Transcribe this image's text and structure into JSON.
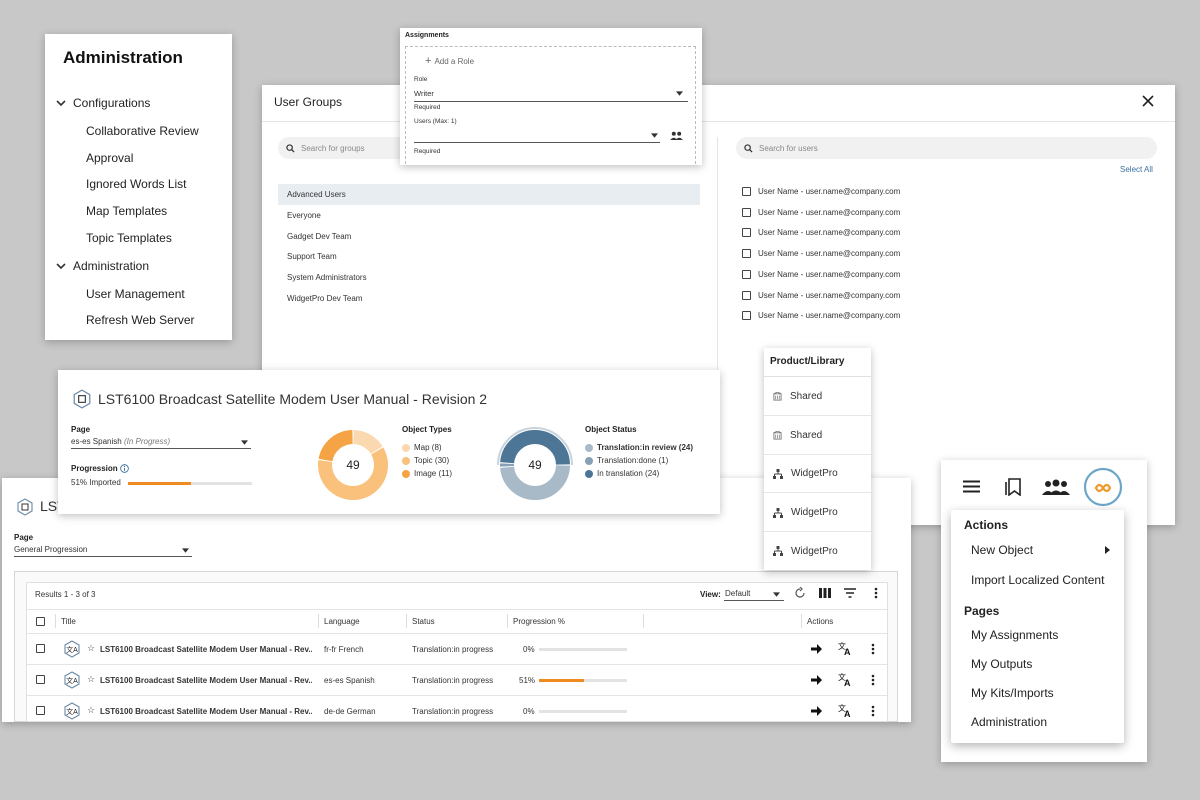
{
  "admin_panel": {
    "title": "Administration",
    "sections": [
      {
        "label": "Configurations",
        "items": [
          "Collaborative Review",
          "Approval",
          "Ignored Words List",
          "Map Templates",
          "Topic Templates"
        ]
      },
      {
        "label": "Administration",
        "items": [
          "User Management",
          "Refresh Web Server"
        ]
      }
    ]
  },
  "user_groups": {
    "title": "User Groups",
    "groups_search_placeholder": "Search for groups",
    "users_search_placeholder": "Search for users",
    "select_all": "Select All",
    "groups": [
      "Advanced Users",
      "Everyone",
      "Gadget Dev Team",
      "Support Team",
      "System Administrators",
      "WidgetPro Dev Team"
    ],
    "selected_group_index": 0,
    "users": [
      "User Name - user.name@company.com",
      "User Name - user.name@company.com",
      "User Name - user.name@company.com",
      "User Name - user.name@company.com",
      "User Name - user.name@company.com",
      "User Name - user.name@company.com",
      "User Name - user.name@company.com"
    ]
  },
  "assignments": {
    "title": "Assignments",
    "add_role": "Add a Role",
    "role_label": "Role",
    "role_value": "Writer",
    "role_helper": "Required",
    "users_label": "Users (Max: 1)",
    "users_value": "",
    "users_helper": "Required"
  },
  "document_card": {
    "title": "LST6100 Broadcast Satellite Modem User Manual - Revision 2",
    "page_label": "Page",
    "page_value": "es-es Spanish",
    "page_value_suffix": "(In Progress)",
    "progression_label": "Progression",
    "progression_text": "51% Imported",
    "progression_percent": 51,
    "object_types": {
      "title": "Object Types",
      "total": "49",
      "items": [
        {
          "label": "Map (8)",
          "value": 8,
          "color": "#fbd9b0"
        },
        {
          "label": "Topic (30)",
          "value": 30,
          "color": "#f9c17c"
        },
        {
          "label": "Image (11)",
          "value": 11,
          "color": "#f4a444"
        }
      ]
    },
    "object_status": {
      "title": "Object Status",
      "total": "49",
      "items": [
        {
          "label": "Translation:in review (24)",
          "value": 24,
          "color": "#a8b9c8"
        },
        {
          "label": "Translation:done (1)",
          "value": 1,
          "color": "#87a0b5"
        },
        {
          "label": "In translation (24)",
          "value": 24,
          "color": "#4d7595"
        }
      ]
    }
  },
  "product_library": {
    "title": "Product/Library",
    "items": [
      {
        "label": "Shared",
        "icon": "library-icon"
      },
      {
        "label": "Shared",
        "icon": "library-icon"
      },
      {
        "label": "WidgetPro",
        "icon": "product-tree-icon"
      },
      {
        "label": "WidgetPro",
        "icon": "product-tree-icon"
      },
      {
        "label": "WidgetPro",
        "icon": "product-tree-icon"
      }
    ]
  },
  "table_panel": {
    "partial_title": "LST",
    "page_label": "Page",
    "page_value": "General Progression",
    "results": "Results 1 - 3 of 3",
    "view_label": "View:",
    "view_value": "Default",
    "columns": [
      "Title",
      "Language",
      "Status",
      "Progression %",
      "Actions"
    ],
    "rows": [
      {
        "title": "LST6100 Broadcast Satellite Modem User Manual - Rev...",
        "language": "fr-fr French",
        "status": "Translation:in progress",
        "progress_text": "0%",
        "progress": 0
      },
      {
        "title": "LST6100 Broadcast Satellite Modem User Manual - Rev...",
        "language": "es-es Spanish",
        "status": "Translation:in progress",
        "progress_text": "51%",
        "progress": 51
      },
      {
        "title": "LST6100 Broadcast Satellite Modem User Manual - Rev...",
        "language": "de-de German",
        "status": "Translation:in progress",
        "progress_text": "0%",
        "progress": 0
      }
    ],
    "accent_color": "#ef8a20"
  },
  "menu": {
    "actions_header": "Actions",
    "new_object": "New Object",
    "import_localized": "Import Localized Content",
    "pages_header": "Pages",
    "pages": [
      "My Assignments",
      "My Outputs",
      "My Kits/Imports",
      "Administration"
    ]
  }
}
